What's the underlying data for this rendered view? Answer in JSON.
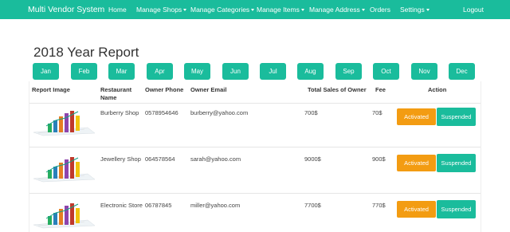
{
  "navbar": {
    "brand": "Multi Vendor System",
    "items": [
      {
        "label": "Home",
        "dropdown": false
      },
      {
        "label": "Manage Shops",
        "dropdown": true
      },
      {
        "label": "Manage Categories",
        "dropdown": true
      },
      {
        "label": "Manage Items",
        "dropdown": true
      },
      {
        "label": "Manage Address",
        "dropdown": true
      },
      {
        "label": "Orders",
        "dropdown": false
      },
      {
        "label": "Settings",
        "dropdown": true
      }
    ],
    "logout": "Logout",
    "color": "#1abc9c"
  },
  "page_title": "2018 Year Report",
  "months": [
    "Jan",
    "Feb",
    "Mar",
    "Apr",
    "May",
    "Jun",
    "Jul",
    "Aug",
    "Sep",
    "Oct",
    "Nov",
    "Dec"
  ],
  "table": {
    "headers": {
      "report_image": "Report Image",
      "restaurant_name": "Restaurant Name",
      "owner_phone": "Owner Phone",
      "owner_email": "Owner Email",
      "total_sales": "Total Sales of Owner",
      "fee": "Fee",
      "action": "Action"
    },
    "rows": [
      {
        "name": "Burberry Shop",
        "phone": "0578954646",
        "email": "burberry@yahoo.com",
        "sales": "700$",
        "fee": "70$",
        "activated": "Activated",
        "suspended": "Suspended"
      },
      {
        "name": "Jewellery Shop",
        "phone": "064578564",
        "email": "sarah@yahoo.com",
        "sales": "9000$",
        "fee": "900$",
        "activated": "Activated",
        "suspended": "Suspended"
      },
      {
        "name": "Electronic Store",
        "phone": "06787845",
        "email": "miller@yahoo.com",
        "sales": "7700$",
        "fee": "770$",
        "activated": "Activated",
        "suspended": "Suspended"
      }
    ]
  },
  "colors": {
    "accent": "#1abc9c",
    "warning": "#f39c12"
  }
}
